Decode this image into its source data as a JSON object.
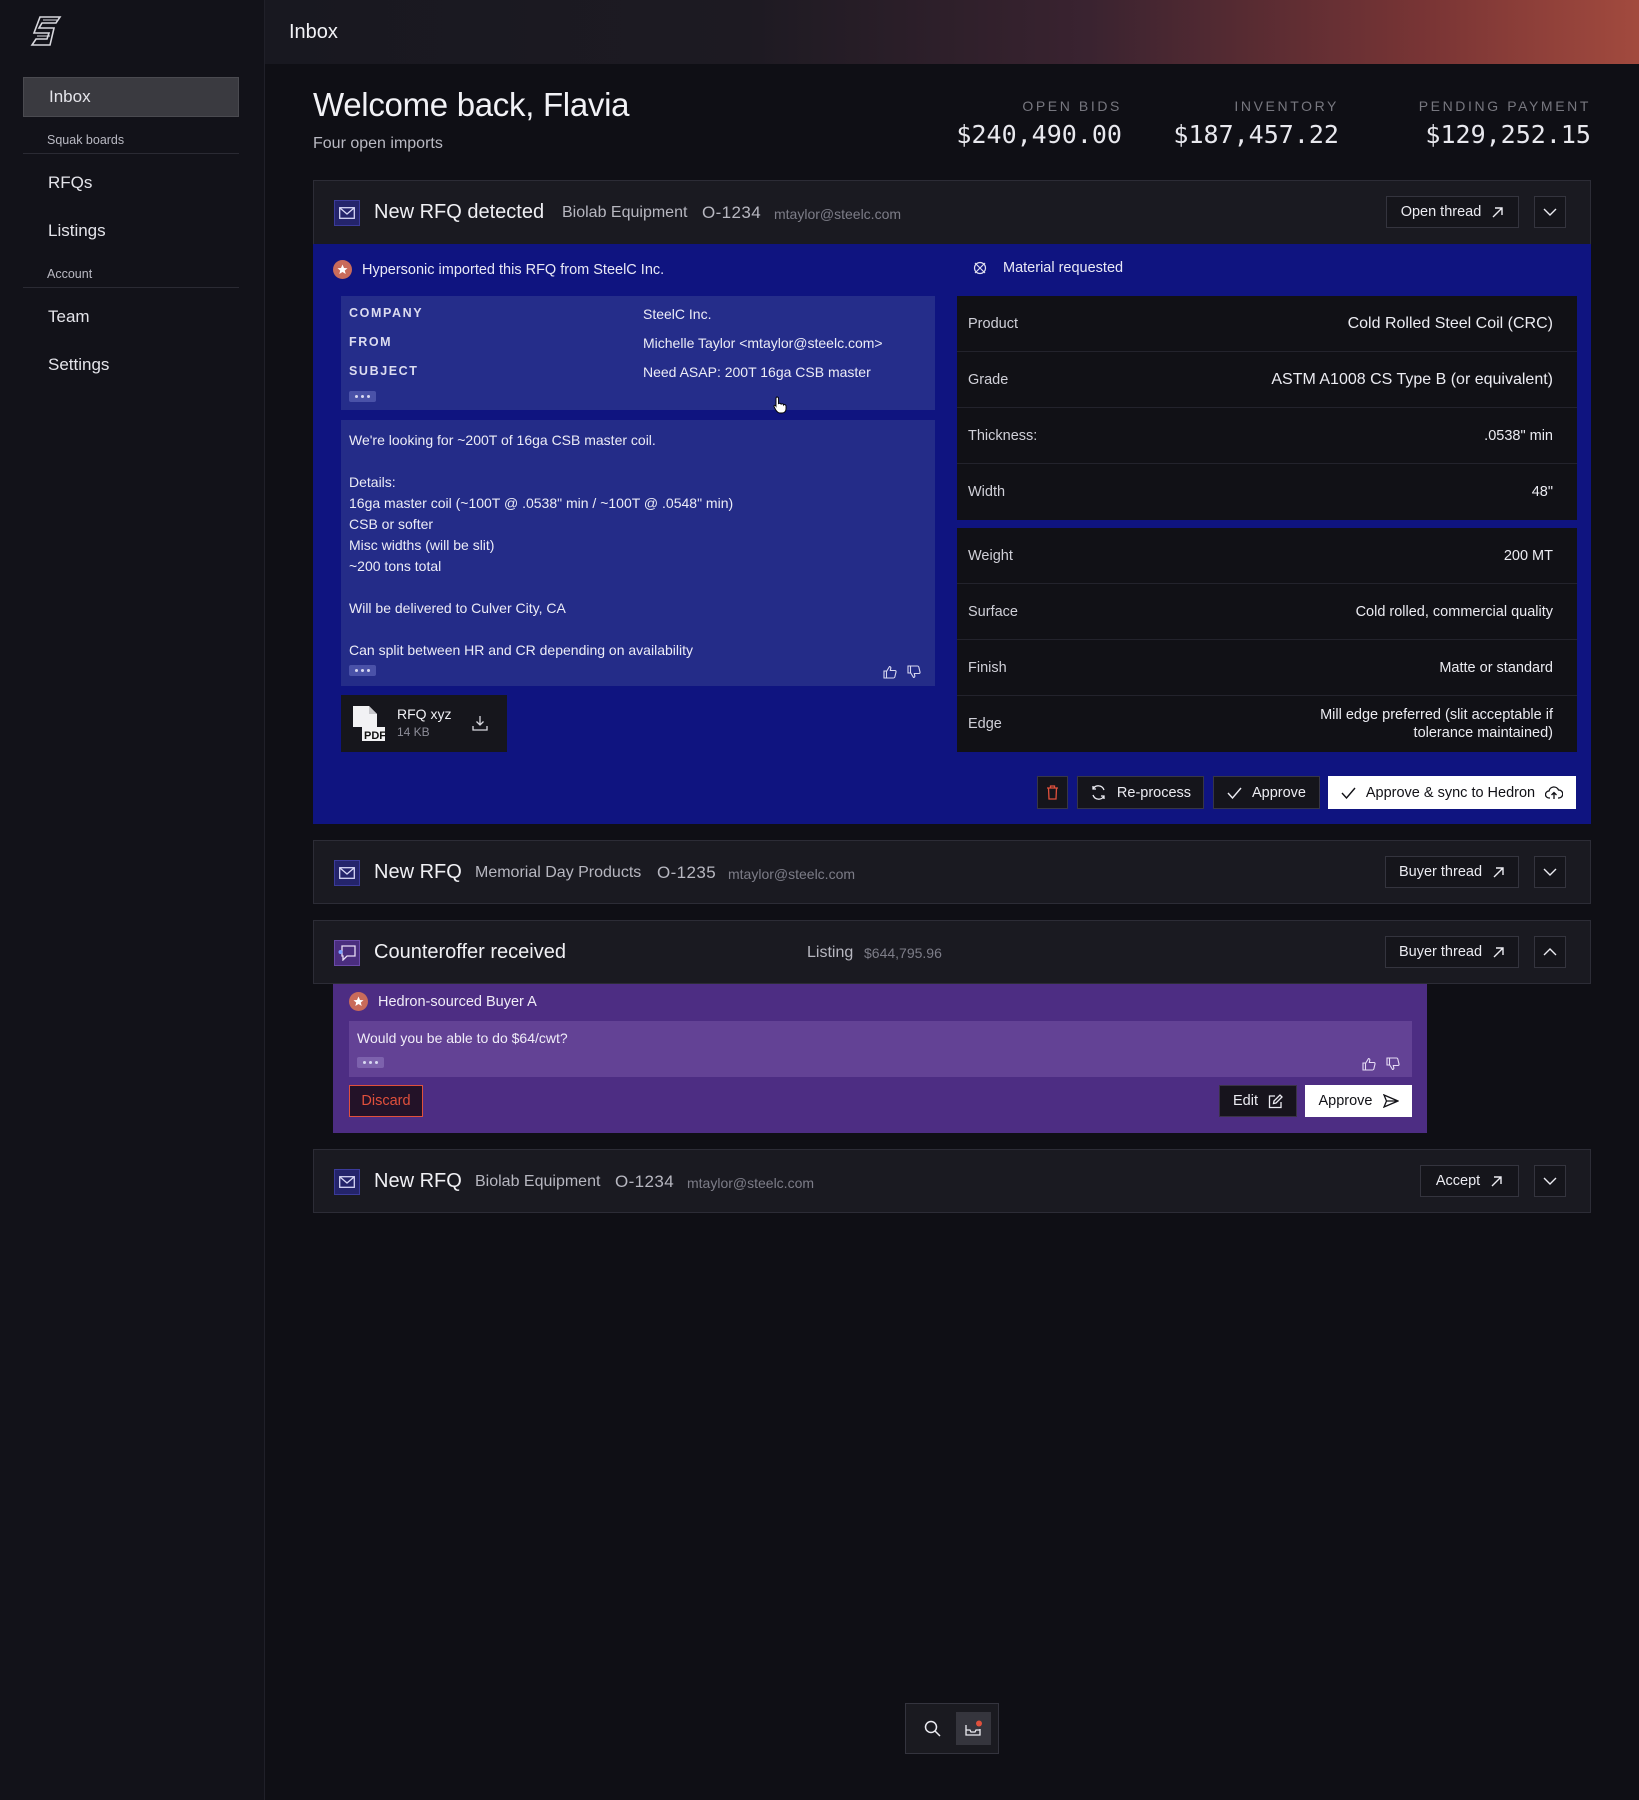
{
  "app": {
    "page_title": "Inbox"
  },
  "sidebar": {
    "inbox": "Inbox",
    "section_boards": "Squak boards",
    "rfqs": "RFQs",
    "listings": "Listings",
    "section_account": "Account",
    "team": "Team",
    "settings": "Settings"
  },
  "header": {
    "welcome": "Welcome back, Flavia",
    "subtitle": "Four open imports"
  },
  "stats": [
    {
      "label": "OPEN BIDS",
      "value": "$240,490.00"
    },
    {
      "label": "INVENTORY",
      "value": "$187,457.22"
    },
    {
      "label": "PENDING PAYMENT",
      "value": "$129,252.15"
    }
  ],
  "card1": {
    "title": "New RFQ detected",
    "company": "Biolab Equipment",
    "order": "O-1234",
    "email": "mtaylor@steelc.com",
    "open_thread": "Open thread",
    "imported_text": "Hypersonic imported this RFQ from SteelC Inc.",
    "meta": {
      "company_key": "COMPANY",
      "company_val": "SteelC Inc.",
      "from_key": "FROM",
      "from_val": "Michelle Taylor <mtaylor@steelc.com>",
      "subject_key": "SUBJECT",
      "subject_val": "Need ASAP: 200T 16ga CSB master"
    },
    "message_lines": [
      "We're looking for ~200T of 16ga CSB master coil.",
      "",
      "Details:",
      "16ga master coil (~100T @ .0538\" min / ~100T @ .0548\" min)",
      "CSB or softer",
      "Misc widths (will be slit)",
      "~200 tons total",
      "",
      "Will be delivered to Culver City, CA",
      "",
      "Can split between HR and CR depending on availability"
    ],
    "attachment": {
      "name": "RFQ xyz",
      "size": "14 KB",
      "type": "PDF"
    },
    "material_heading": "Material requested",
    "specs_primary": [
      {
        "key": "Product",
        "value": "Cold Rolled Steel Coil (CRC)"
      },
      {
        "key": "Grade",
        "value": "ASTM A1008 CS Type B (or equivalent)"
      },
      {
        "key": "Thickness:",
        "value": ".0538\" min"
      },
      {
        "key": "Width",
        "value": "48\""
      }
    ],
    "specs_secondary": [
      {
        "key": "Weight",
        "value": "200 MT"
      },
      {
        "key": "Surface",
        "value": "Cold rolled, commercial quality"
      },
      {
        "key": "Finish",
        "value": "Matte or standard"
      },
      {
        "key": "Edge",
        "value_line1": "Mill edge preferred (slit acceptable if",
        "value_line2": "tolerance maintained)"
      }
    ],
    "actions": {
      "reprocess": "Re-process",
      "approve": "Approve",
      "approve_sync": "Approve & sync to Hedron"
    }
  },
  "card2": {
    "title": "New RFQ",
    "company": "Memorial Day Products",
    "order": "O-1235",
    "email": "mtaylor@steelc.com",
    "button": "Buyer thread"
  },
  "card3": {
    "title": "Counteroffer received",
    "listing_label": "Listing",
    "listing_amount": "$644,795.96",
    "button": "Buyer thread",
    "buyer": "Hedron-sourced Buyer A",
    "message": "Would you be able to do $64/cwt?",
    "discard": "Discard",
    "edit": "Edit",
    "approve": "Approve"
  },
  "card4": {
    "title": "New RFQ",
    "company": "Biolab Equipment",
    "order": "O-1234",
    "email": "mtaylor@steelc.com",
    "button": "Accept"
  },
  "colors": {
    "rfq_panel": "#0f1480",
    "counteroffer_panel": "#4d2d83",
    "discard": "#e0503c",
    "notification_dot": "#e0503c"
  }
}
